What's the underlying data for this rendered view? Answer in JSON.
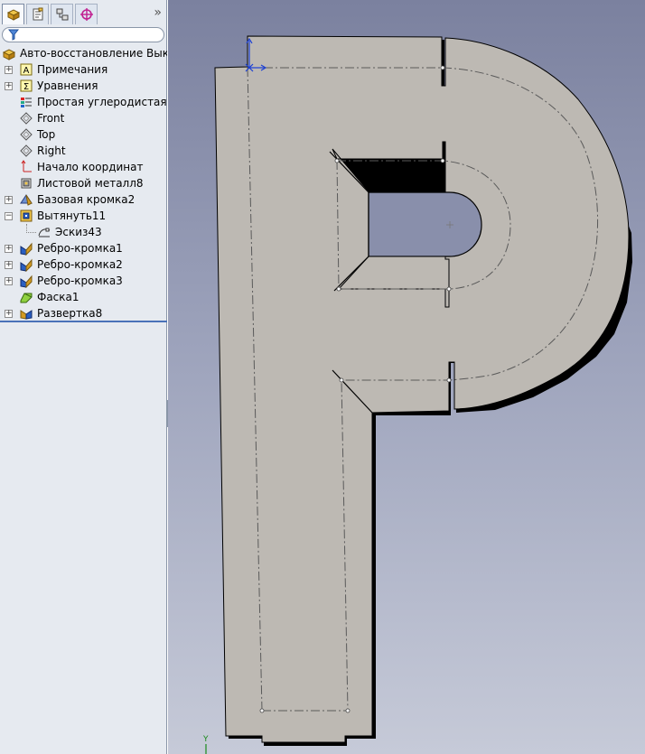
{
  "panel": {
    "tabs": [
      {
        "name": "featuremanager-tab-icon"
      },
      {
        "name": "propertymanager-tab-icon"
      },
      {
        "name": "configurationmanager-tab-icon"
      },
      {
        "name": "dimxpert-tab-icon"
      }
    ],
    "expand_symbol": "»",
    "filter_value": ""
  },
  "tree": {
    "root_label": "Авто-восстановление Выкройка",
    "items": [
      {
        "label": "Примечания",
        "icon": "annotations-icon",
        "expandable": true
      },
      {
        "label": "Уравнения",
        "icon": "equations-icon",
        "expandable": true
      },
      {
        "label": "Простая углеродистая сталь",
        "icon": "material-icon",
        "expandable": false
      },
      {
        "label": "Front",
        "icon": "plane-icon",
        "expandable": false
      },
      {
        "label": "Top",
        "icon": "plane-icon",
        "expandable": false
      },
      {
        "label": "Right",
        "icon": "plane-icon",
        "expandable": false
      },
      {
        "label": "Начало координат",
        "icon": "origin-icon",
        "expandable": false
      },
      {
        "label": "Листовой металл8",
        "icon": "sheet-metal-icon",
        "expandable": false
      },
      {
        "label": "Базовая кромка2",
        "icon": "base-flange-icon",
        "expandable": true
      },
      {
        "label": "Вытянуть11",
        "icon": "extrude-icon",
        "expandable": true,
        "expanded": true
      },
      {
        "label": "Эскиз43",
        "icon": "sketch-icon",
        "expandable": false,
        "child": true
      },
      {
        "label": "Ребро-кромка1",
        "icon": "edge-flange-icon",
        "expandable": true
      },
      {
        "label": "Ребро-кромка2",
        "icon": "edge-flange-icon",
        "expandable": true
      },
      {
        "label": "Ребро-кромка3",
        "icon": "edge-flange-icon",
        "expandable": true
      },
      {
        "label": "Фаска1",
        "icon": "chamfer-icon",
        "expandable": false
      },
      {
        "label": "Развертка8",
        "icon": "flatten-icon",
        "expandable": true
      }
    ]
  },
  "viewport": {
    "background_top": "#7b819f",
    "background_bottom": "#c6cad8",
    "part_face_color": "#bdb9b3",
    "edge_color": "#000000",
    "bend_line_color": "#5a5a5a",
    "triad_label": "Y"
  }
}
